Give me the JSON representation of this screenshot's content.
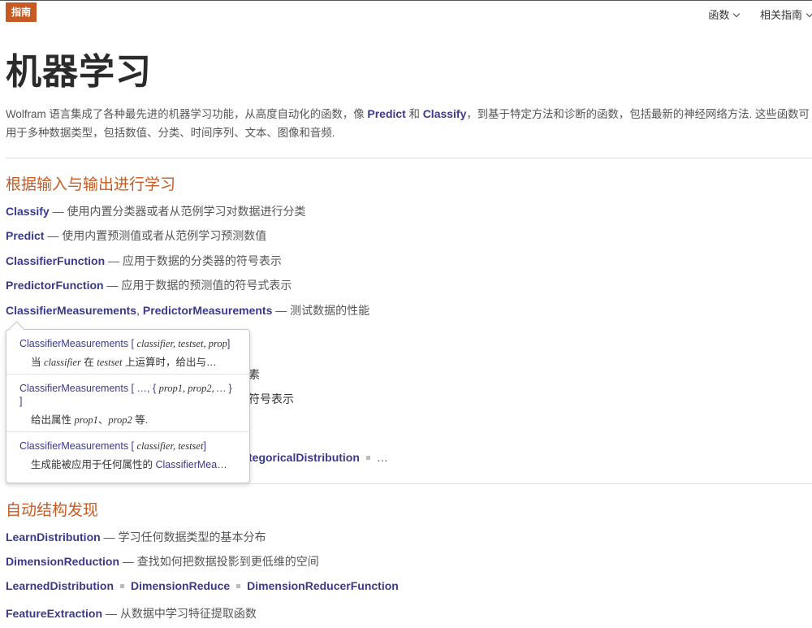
{
  "header": {
    "badge": "指南",
    "nav": [
      {
        "label": "函数"
      },
      {
        "label": "相关指南"
      }
    ]
  },
  "page_title": "机器学习",
  "intro": {
    "before": "Wolfram 语言集成了各种最先进的机器学习功能，从高度自动化的函数，像 ",
    "link1": "Predict",
    "mid1": " 和 ",
    "link2": "Classify",
    "after": "，到基于特定方法和诊断的函数，包括最新的神经网络方法. 这些函数可用于多种数据类型，包括数值、分类、时间序列、文本、图像和音频."
  },
  "section1": {
    "title": "根据输入与输出进行学习",
    "rows": [
      {
        "link": "Classify",
        "desc": " — 使用内置分类器或者从范例学习对数据进行分类"
      },
      {
        "link": "Predict",
        "desc": " — 使用内置预测值或者从范例学习预测数值"
      },
      {
        "link": "ClassifierFunction",
        "desc": " — 应用于数据的分类器的符号表示"
      },
      {
        "link": "PredictorFunction",
        "desc": " — 应用于数据的预测值的符号式表示"
      }
    ],
    "measurements": {
      "link1": "ClassifierMeasurements",
      "sep": ", ",
      "link2": "PredictorMeasurements",
      "desc": " — 测试数据的性能"
    },
    "partial_row1": "素",
    "partial_row2": "符号表示",
    "partial_row3_link": "tegoricalDistribution",
    "partial_row3_ellipsis": "…"
  },
  "popup": {
    "items": [
      {
        "func": "ClassifierMeasurements",
        "sig_open": " [ ",
        "args": "classifier, testset, prop",
        "sig_close": "]",
        "desc_pre": "当 ",
        "desc_arg1": "classifier",
        "desc_mid": " 在 ",
        "desc_arg2": "testset",
        "desc_post": " 上运算时，给出与…"
      },
      {
        "func": "ClassifierMeasurements",
        "sig_open": " [ …, { ",
        "args": "prop1, prop2, …",
        "sig_close": " } ]",
        "desc_pre": "给出属性 ",
        "desc_arg1": "prop1",
        "desc_mid": "、",
        "desc_arg2": "prop2",
        "desc_post": " 等."
      },
      {
        "func": "ClassifierMeasurements",
        "sig_open": " [ ",
        "args": "classifier, testset",
        "sig_close": "]",
        "desc_pre": "生成能被应用于任何属性的 ",
        "desc_link": "ClassifierMea…"
      }
    ]
  },
  "section2": {
    "title": "自动结构发现",
    "rows": [
      {
        "link": "LearnDistribution",
        "desc": " — 学习任何数据类型的基本分布"
      },
      {
        "link": "DimensionReduction",
        "desc": " — 查找如何把数据投影到更低维的空间"
      }
    ],
    "related": [
      "LearnedDistribution",
      "DimensionReduce",
      "DimensionReducerFunction"
    ],
    "feature": {
      "link": "FeatureExtraction",
      "desc": " — 从数据中学习特征提取函数"
    }
  },
  "colors": {
    "accent": "#c65a22",
    "link": "#3a3a8c"
  }
}
